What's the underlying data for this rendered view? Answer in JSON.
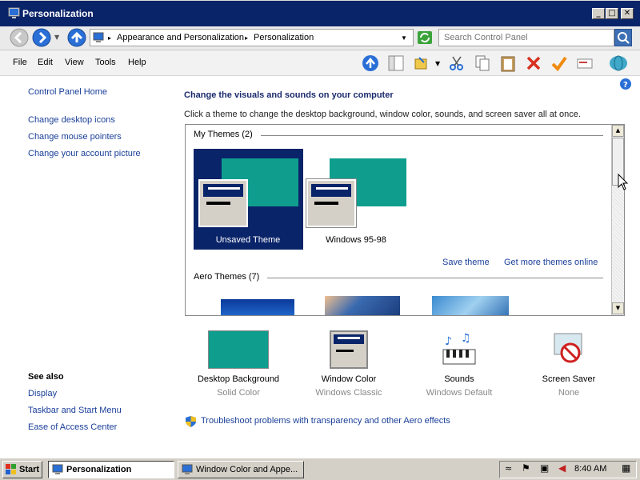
{
  "window": {
    "title": "Personalization"
  },
  "address": {
    "crumbs": [
      "Appearance and Personalization",
      "Personalization"
    ],
    "search_placeholder": "Search Control Panel"
  },
  "menu": [
    "File",
    "Edit",
    "View",
    "Tools",
    "Help"
  ],
  "sidebar": {
    "home": "Control Panel Home",
    "tasks": [
      "Change desktop icons",
      "Change mouse pointers",
      "Change your account picture"
    ],
    "see_also_title": "See also",
    "see_also": [
      "Display",
      "Taskbar and Start Menu",
      "Ease of Access Center"
    ]
  },
  "main": {
    "heading": "Change the visuals and sounds on your computer",
    "subheading": "Click a theme to change the desktop background, window color, sounds, and screen saver all at once.",
    "my_themes_title": "My Themes (2)",
    "themes": [
      {
        "name": "Unsaved Theme",
        "selected": true
      },
      {
        "name": "Windows 95-98",
        "selected": false
      }
    ],
    "save_theme": "Save theme",
    "get_more": "Get more themes online",
    "aero_title": "Aero Themes (7)"
  },
  "bottom": [
    {
      "title": "Desktop Background",
      "value": "Solid Color"
    },
    {
      "title": "Window Color",
      "value": "Windows Classic"
    },
    {
      "title": "Sounds",
      "value": "Windows Default"
    },
    {
      "title": "Screen Saver",
      "value": "None"
    }
  ],
  "troubleshoot": "Troubleshoot problems with transparency and other Aero effects",
  "taskbar": {
    "start": "Start",
    "items": [
      "Personalization",
      "Window Color and Appe..."
    ],
    "clock": "8:40 AM"
  },
  "colors": {
    "teal": "#0f9e8e",
    "titlebar": "#0a246a",
    "link": "#1a3f99"
  }
}
